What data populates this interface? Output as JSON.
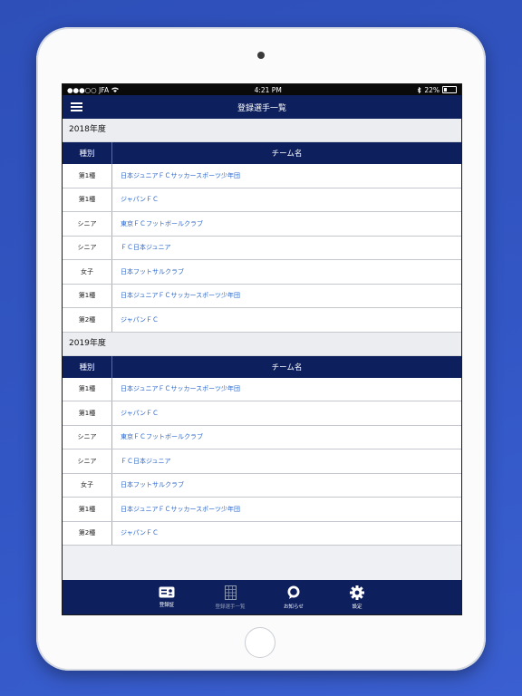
{
  "status": {
    "carrier": "●●●○○ JFA",
    "time": "4:21 PM",
    "battery": "22%"
  },
  "nav": {
    "title": "登録選手一覧"
  },
  "columns": {
    "category": "種別",
    "team": "チーム名"
  },
  "sections": [
    {
      "year": "2018年度",
      "rows": [
        {
          "category": "第1種",
          "team": "日本ジュニアＦＣサッカースポーツ少年団"
        },
        {
          "category": "第1種",
          "team": "ジャパンＦＣ"
        },
        {
          "category": "シニア",
          "team": "東京ＦＣフットボールクラブ"
        },
        {
          "category": "シニア",
          "team": "ＦＣ日本ジュニア"
        },
        {
          "category": "女子",
          "team": "日本フットサルクラブ"
        },
        {
          "category": "第1種",
          "team": "日本ジュニアＦＣサッカースポーツ少年団"
        },
        {
          "category": "第2種",
          "team": "ジャパンＦＣ"
        }
      ]
    },
    {
      "year": "2019年度",
      "rows": [
        {
          "category": "第1種",
          "team": "日本ジュニアＦＣサッカースポーツ少年団"
        },
        {
          "category": "第1種",
          "team": "ジャパンＦＣ"
        },
        {
          "category": "シニア",
          "team": "東京ＦＣフットボールクラブ"
        },
        {
          "category": "シニア",
          "team": "ＦＣ日本ジュニア"
        },
        {
          "category": "女子",
          "team": "日本フットサルクラブ"
        },
        {
          "category": "第1種",
          "team": "日本ジュニアＦＣサッカースポーツ少年団"
        },
        {
          "category": "第2種",
          "team": "ジャパンＦＣ"
        }
      ]
    }
  ],
  "tabs": [
    {
      "label": "登録証",
      "icon": "id-card-icon"
    },
    {
      "label": "登録選手一覧",
      "icon": "list-sheet-icon"
    },
    {
      "label": "お知らせ",
      "icon": "speech-bubble-icon"
    },
    {
      "label": "設定",
      "icon": "gear-icon"
    }
  ],
  "colors": {
    "navy": "#0d1f5c",
    "link": "#2f68c9",
    "background": "#3256c4"
  }
}
